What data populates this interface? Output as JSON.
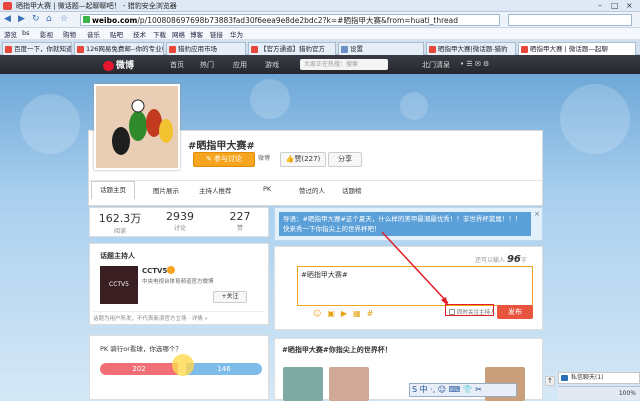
{
  "browser": {
    "window_title": "晒指甲大赛 | 微话题—起聊聊吧！ - 猎豹安全浏览器",
    "url_host": "weibo.com",
    "url_path": "/p/100808697698b73883fad30f6eea9e8de2bdc2?k=#晒指甲大赛&from=huati_thread",
    "favorites": [
      "游览",
      "bs",
      "影视",
      "购物",
      "音乐",
      "贴吧",
      "技术",
      "下载",
      "网络",
      "博客",
      "链接",
      "华为"
    ],
    "tabs": [
      "百度一下，你就知道",
      "126网易免费邮--你的专业电",
      "猎豹应用市场",
      "【官方通道】猎豹官方",
      "设置",
      "晒指甲大赛|微话题-猎豹",
      "晒指甲大赛 | 微话题—起聊"
    ],
    "accent": "#3b6fb6"
  },
  "weibo_nav": {
    "logo": "微博",
    "items": [
      "首页",
      "热门",
      "应用",
      "游戏"
    ],
    "search_placeholder": "大家正在热搜：搜索",
    "user": "北门清泉"
  },
  "topic": {
    "title": "#晒指甲大赛#",
    "join_label": "参与讨论",
    "host_tag": "微博",
    "like_label": "赞(227)",
    "share_label": "分享",
    "tabs": [
      "话题主页",
      "图片展示",
      "主持人推荐",
      "PK",
      "赞过的人",
      "话题榜"
    ]
  },
  "stats": [
    {
      "value": "162.3万",
      "label": "阅读"
    },
    {
      "value": "2939",
      "label": "讨论"
    },
    {
      "value": "227",
      "label": "赞"
    }
  ],
  "host": {
    "heading": "话题主持人",
    "name": "CCTV5",
    "logo_text": "CCTV5",
    "description": "中央电视台体育频道官方微博",
    "follow_label": "+关注",
    "note": "话题为用户所发，不代表新浪官方立场 · 详情 »"
  },
  "pk": {
    "heading": "PK 骑行or看球，你选哪个？",
    "left_value": "202",
    "right_value": "146",
    "left_color": "#f06f77",
    "right_color": "#7dbbe9"
  },
  "guide": {
    "text": "导语：#晒指甲大赛#这个夏天，什么样的美甲最潮最优秀！！非世界杯莫属！！！快来秀一下你指尖上的世界杯吧！",
    "close": "×"
  },
  "composer": {
    "count_prefix": "还可以输入",
    "count_value": "96",
    "count_suffix": "字",
    "text": "#晒指甲大赛#",
    "checkbox_label": "同时关注主持人",
    "publish_label": "发布"
  },
  "feed": {
    "heading": "#晒指甲大赛#你指尖上的世界杯！"
  },
  "overlay": {
    "chat_label": "私信聊天(1)",
    "ime_label": "S 中 ·, ☺ ⌨ 👕 ✂",
    "status": "100%"
  }
}
